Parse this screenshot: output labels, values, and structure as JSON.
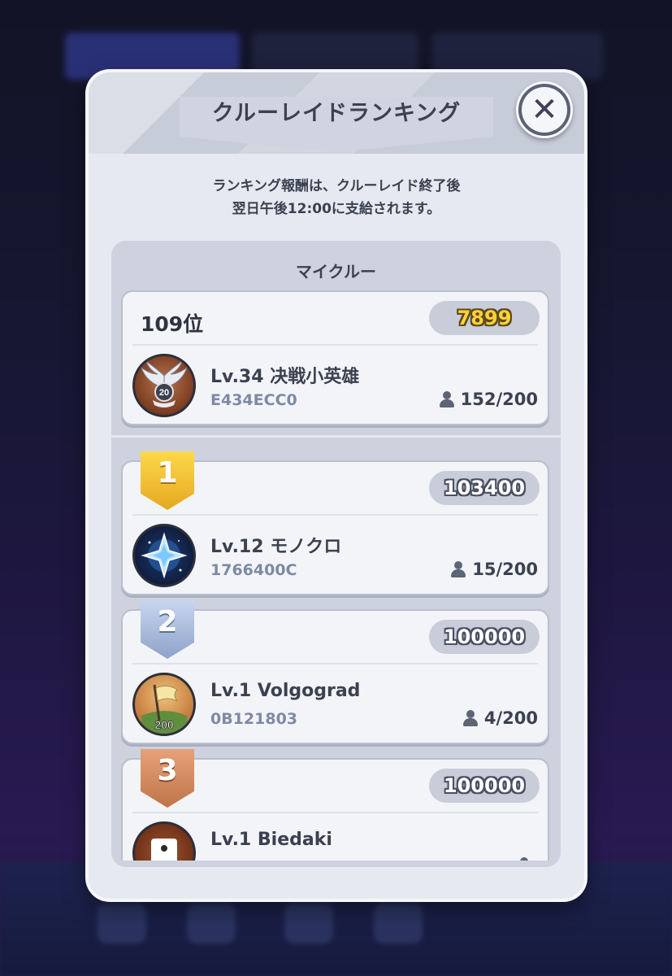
{
  "modal": {
    "title": "クルーレイドランキング",
    "close_icon": "✕",
    "notice_line1": "ランキング報酬は、クルーレイド終了後",
    "notice_line2": "翌日午後12:00に支給されます。"
  },
  "my_crew": {
    "section_title": "マイクルー",
    "rank_label": "109位",
    "score": "7899",
    "name": "Lv.34 决戦小英雄",
    "crew_id": "E434ECC0",
    "members": "152/200",
    "emblem_label": "20"
  },
  "rankings": [
    {
      "rank": "1",
      "score": "103400",
      "name": "Lv.12 モノクロ",
      "crew_id": "1766400C",
      "members": "15/200",
      "emblem": "star-emblem-icon"
    },
    {
      "rank": "2",
      "score": "100000",
      "name": "Lv.1 Volgograd",
      "crew_id": "0B121803",
      "members": "4/200",
      "emblem": "flag-emblem-icon",
      "emblem_label": "200"
    },
    {
      "rank": "3",
      "score": "100000",
      "name": "Lv.1 Biedaki",
      "crew_id": "",
      "members": "",
      "emblem": "dice-emblem-icon"
    }
  ],
  "colors": {
    "gold_badge": "#e4a821",
    "silver_badge": "#8ea3c9",
    "bronze_badge": "#c07449",
    "score_gold": "#ffd23a"
  }
}
